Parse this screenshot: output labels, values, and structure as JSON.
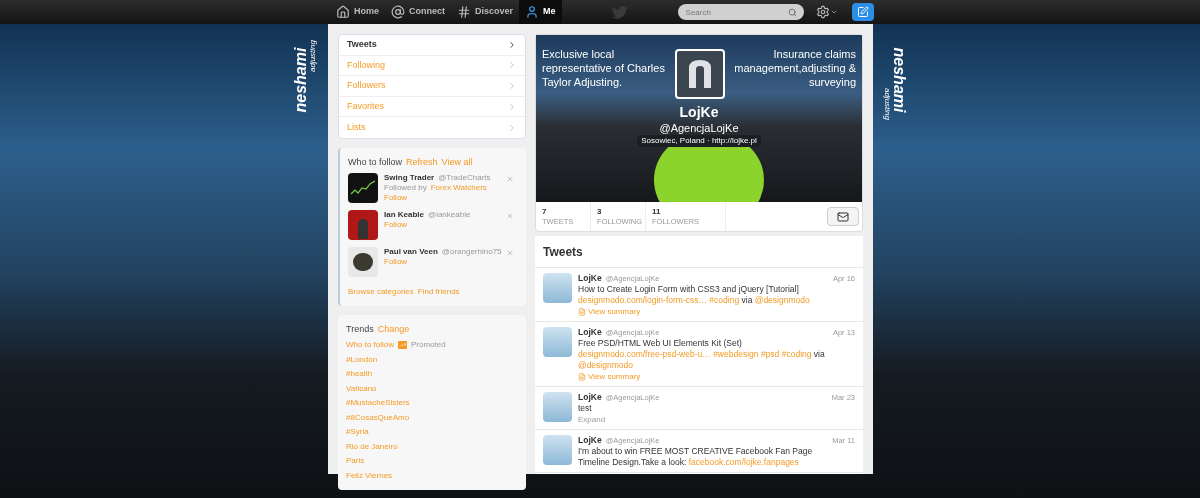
{
  "topbar": {
    "nav": [
      {
        "label": "Home",
        "selected": false
      },
      {
        "label": "Connect",
        "selected": false
      },
      {
        "label": "Discover",
        "selected": false
      },
      {
        "label": "Me",
        "selected": true
      }
    ],
    "search": {
      "placeholder": "Search"
    }
  },
  "background_logos": [
    {
      "name": "neshami",
      "tagline": "adjusting"
    },
    {
      "name": "neshami",
      "tagline": "adjusting"
    }
  ],
  "nav_menu": [
    {
      "label": "Tweets",
      "selected": true
    },
    {
      "label": "Following",
      "selected": false
    },
    {
      "label": "Followers",
      "selected": false
    },
    {
      "label": "Favorites",
      "selected": false
    },
    {
      "label": "Lists",
      "selected": false
    }
  ],
  "who_to_follow": {
    "title": "Who to follow",
    "links": [
      "Refresh",
      "View all"
    ],
    "suggestions": [
      {
        "name": "Swing Trader",
        "handle": "@TradeCharts",
        "followed_by_prefix": "Followed by",
        "followed_by": "Forex Watchers",
        "action": "Follow"
      },
      {
        "name": "Ian Keable",
        "handle": "@iankeable",
        "action": "Follow"
      },
      {
        "name": "Paul van Veen",
        "handle": "@orangerhino75",
        "action": "Follow"
      }
    ],
    "footer_links": [
      "Browse categories",
      "Find friends"
    ]
  },
  "trends": {
    "title": "Trends",
    "change": "Change",
    "items": [
      {
        "kind": "promoted",
        "text": "Who to follow",
        "badge": "Promoted"
      },
      {
        "kind": "trend",
        "text": "#London"
      },
      {
        "kind": "trend",
        "text": "#health"
      },
      {
        "kind": "trend",
        "text": "Vaticano"
      },
      {
        "kind": "trend",
        "text": "#MustacheSisters"
      },
      {
        "kind": "trend",
        "text": "#8CosasQueAmo"
      },
      {
        "kind": "trend",
        "text": "#Syria"
      },
      {
        "kind": "trend",
        "text": "Rio de Janeiro"
      },
      {
        "kind": "trend",
        "text": "Paris"
      },
      {
        "kind": "trend",
        "text": "Feliz Viernes"
      }
    ]
  },
  "profile": {
    "banner_left": "Exclusive local representative of Charles Taylor Adjusting.",
    "banner_right": "Insurance claims management,adjusting & surveying",
    "name": "LojKe",
    "handle": "@AgencjaLojKe",
    "location": "Sosowiec, Poland · http://lojke.pl",
    "stats": [
      {
        "value": "7",
        "label": "TWEETS"
      },
      {
        "value": "3",
        "label": "FOLLOWING"
      },
      {
        "value": "11",
        "label": "FOLLOWERS"
      }
    ]
  },
  "tweets": {
    "title": "Tweets",
    "items": [
      {
        "name": "LojKe",
        "handle": "@AgencjaLojKe",
        "date": "Apr 16",
        "parts": [
          {
            "text": "How to Create Login Form with CSS3 and jQuery [Tutorial]",
            "link": false
          },
          {
            "text": "designmodo.com/login-form-css…",
            "link": true
          },
          {
            "text": "#coding",
            "link": true
          },
          {
            "text": "via",
            "link": false
          },
          {
            "text": "@designmodo",
            "link": true
          }
        ],
        "action": {
          "kind": "summary",
          "label": "View summary"
        }
      },
      {
        "name": "LojKe",
        "handle": "@AgencjaLojKe",
        "date": "Apr 13",
        "parts": [
          {
            "text": "Free PSD/HTML Web UI Elements Kit (Set)",
            "link": false
          },
          {
            "text": "designmodo.com/free-psd-web-u…",
            "link": true
          },
          {
            "text": "#webdesign",
            "link": true
          },
          {
            "text": "#psd",
            "link": true
          },
          {
            "text": "#coding",
            "link": true
          },
          {
            "text": "via",
            "link": false
          },
          {
            "text": "@designmodo",
            "link": true
          }
        ],
        "action": {
          "kind": "summary",
          "label": "View summary"
        }
      },
      {
        "name": "LojKe",
        "handle": "@AgencjaLojKe",
        "date": "Mar 23",
        "parts": [
          {
            "text": "test",
            "link": false
          }
        ],
        "action": {
          "kind": "expand",
          "label": "Expand"
        }
      },
      {
        "name": "LojKe",
        "handle": "@AgencjaLojKe",
        "date": "Mar 11",
        "parts": [
          {
            "text": "I'm about to win FREE MOST CREATIVE Facebook Fan Page",
            "link": false
          },
          {
            "text": "Timeline Design.Take a look:",
            "link": false
          },
          {
            "text": "facebook.com/lojke.fanpages",
            "link": true
          }
        ]
      }
    ]
  }
}
